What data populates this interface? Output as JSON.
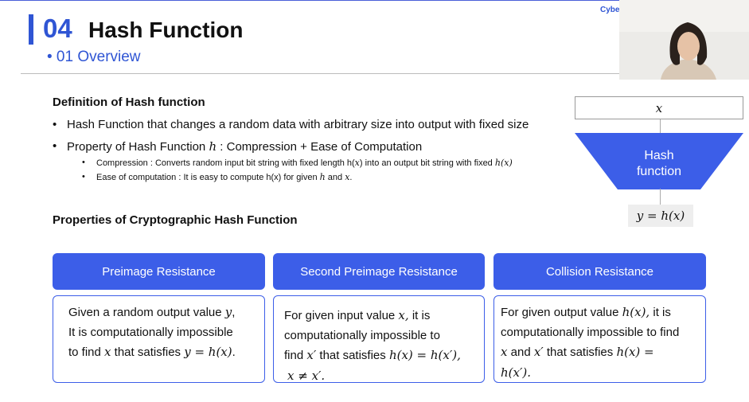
{
  "header": {
    "section_number": "04",
    "section_title": "Hash Function",
    "subtitle": "• 01 Overview",
    "brand": "Cybe"
  },
  "definition": {
    "heading": "Definition of Hash function",
    "bullets": [
      "Hash Function that changes a random data with arbitrary size into output with fixed size",
      "Property of Hash Function"
    ],
    "bullet2_h": "h",
    "bullet2_tail": ": Compression +  Ease of Computation",
    "sub1_a": "Compression : Converts random input bit string with fixed length h(",
    "sub1_x": "x",
    "sub1_b": ") into an output bit string with fixed ",
    "sub1_hx": "h(x)",
    "sub2_a": "Ease of computation : It is easy to compute h(x) for given ",
    "sub2_h": "h",
    "sub2_b": " and ",
    "sub2_x": "x",
    "sub2_c": "."
  },
  "properties": {
    "heading": "Properties of Cryptographic Hash Function",
    "cards": [
      {
        "title": "Preimage Resistance",
        "l1a": "Given a random output value ",
        "l1m": "y",
        "l1b": ",",
        "l2": "It is computationally impossible",
        "l3a": "to find ",
        "l3m1": "x",
        "l3b": " that satisfies ",
        "l3m2": "y = h(x)",
        "l3c": "."
      },
      {
        "title": "Second Preimage Resistance",
        "l1a": "For given input value ",
        "l1m": "x,",
        "l1b": " it is",
        "l2": "computationally impossible to",
        "l3a": "find ",
        "l3m1": "x′",
        "l3b": " that satisfies ",
        "l3m2": "h(x) = h(x′),",
        "l4": "x ≠ x′."
      },
      {
        "title": "Collision Resistance",
        "l1a": "For given output value ",
        "l1m": "h(x),",
        "l1b": " it is",
        "l2": "computationally impossible to find",
        "l3m1": "x",
        "l3a": " and ",
        "l3m2": "x′",
        "l3b": " that satisfies  ",
        "l3m3": "h(x) =",
        "l4": "h(x′)."
      }
    ]
  },
  "diagram": {
    "input": "x",
    "box_label_1": "Hash",
    "box_label_2": "function",
    "output": "y = h(x)",
    "color": "#3c5ee8"
  },
  "colors": {
    "accent": "#2f55d4",
    "pill": "#3c5ee8"
  },
  "icons": [
    "presenter-webcam"
  ]
}
